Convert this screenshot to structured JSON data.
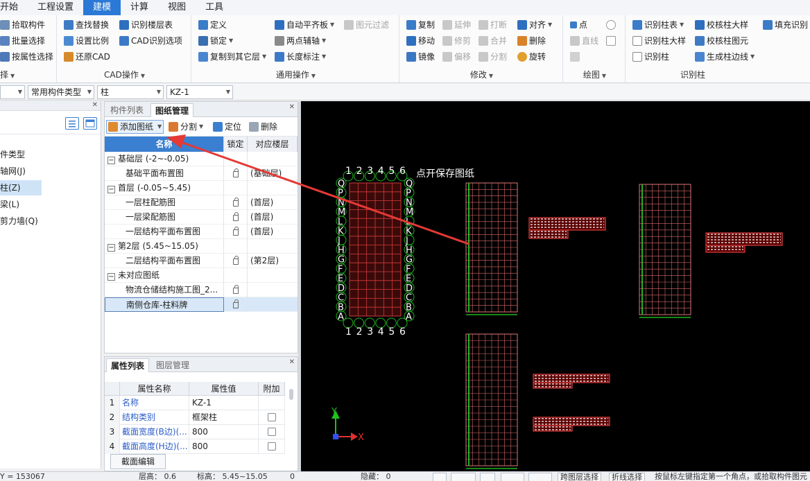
{
  "menu": [
    "开始",
    "工程设置",
    "建模",
    "计算",
    "视图",
    "工具"
  ],
  "ribbon": {
    "select_group": {
      "items": [
        "拾取构件",
        "批量选择",
        "按属性选择"
      ],
      "title": "择"
    },
    "cad_group": {
      "items": [
        "查找替换",
        "设置比例",
        "还原CAD",
        "识别楼层表",
        "CAD识别选项"
      ],
      "title": "CAD操作"
    },
    "general_group": {
      "items": [
        "定义",
        "锁定",
        "复制到其它层",
        "自动平齐板",
        "两点辅轴",
        "长度标注",
        "图元过滤"
      ],
      "title": "通用操作"
    },
    "modify_group": {
      "items": [
        "复制",
        "移动",
        "镜像",
        "延伸",
        "修剪",
        "偏移",
        "打断",
        "合并",
        "分割",
        "对齐",
        "删除",
        "旋转"
      ],
      "title": "修改"
    },
    "draw_group": {
      "items": [
        "点",
        "直线"
      ],
      "title": "绘图"
    },
    "recog_group": {
      "items": [
        "识别柱表",
        "识别柱大样",
        "识别柱",
        "校核柱大样",
        "校核柱图元",
        "生成柱边线",
        "填充识别"
      ],
      "title": "识别柱"
    }
  },
  "combos": [
    "",
    "常用构件类型",
    "柱",
    "KZ-1"
  ],
  "left_tree": [
    "件类型",
    "轴网(J)",
    "柱(Z)",
    "梁(L)",
    "剪力墙(Q)"
  ],
  "drawing_panel": {
    "tabs": [
      "构件列表",
      "图纸管理"
    ],
    "tools": [
      "添加图纸",
      "分割",
      "定位",
      "删除"
    ],
    "columns": [
      "名称",
      "锁定",
      "对应楼层"
    ],
    "rows": [
      {
        "type": "group",
        "name": "基础层 (-2~-0.05)",
        "floor": ""
      },
      {
        "type": "item",
        "name": "基础平面布置图",
        "floor": "(基础层)"
      },
      {
        "type": "group",
        "name": "首层 (-0.05~5.45)",
        "floor": ""
      },
      {
        "type": "item",
        "name": "一层柱配筋图",
        "floor": "(首层)"
      },
      {
        "type": "item",
        "name": "一层梁配筋图",
        "floor": "(首层)"
      },
      {
        "type": "item",
        "name": "一层结构平面布置图",
        "floor": "(首层)"
      },
      {
        "type": "group",
        "name": "第2层 (5.45~15.05)",
        "floor": ""
      },
      {
        "type": "item",
        "name": "二层结构平面布置图",
        "floor": "(第2层)"
      },
      {
        "type": "group",
        "name": "未对应图纸",
        "floor": ""
      },
      {
        "type": "item",
        "name": "物流仓储结构施工图_2...",
        "floor": ""
      },
      {
        "type": "item",
        "name": "南侧仓库-柱料牌",
        "floor": "",
        "selected": true
      }
    ]
  },
  "property_panel": {
    "tabs": [
      "属性列表",
      "图层管理"
    ],
    "columns": [
      "属性名称",
      "属性值",
      "附加"
    ],
    "rows": [
      {
        "num": "1",
        "name": "名称",
        "value": "KZ-1",
        "check": false
      },
      {
        "num": "2",
        "name": "结构类别",
        "value": "框架柱",
        "check": true
      },
      {
        "num": "3",
        "name": "截面宽度(B边)(...",
        "value": "800",
        "check": true
      },
      {
        "num": "4",
        "name": "截面高度(H边)(...",
        "value": "800",
        "check": true
      }
    ],
    "section_edit": "截面编辑"
  },
  "canvas": {
    "annotation": "点开保存图纸",
    "axis_numbers": "123456",
    "axis_letters": [
      "Q",
      "P",
      "N",
      "M",
      "L",
      "K",
      "J",
      "H",
      "G",
      "F",
      "E",
      "D",
      "C",
      "B",
      "A"
    ],
    "axis_y": "Y",
    "axis_x": "X"
  },
  "status": {
    "coord": "Y = 153067",
    "floor_height": "层高：  0.6",
    "elevation": "标高：  5.45~15.05",
    "zero": "0",
    "hidden": "隐藏：  0",
    "btn_layer": "跨图层选择",
    "btn_poly": "折线选择",
    "hint": "按鼠标左键指定第一个角点，或拾取构件图元"
  },
  "colors": {
    "accent": "#2b79d6",
    "arrow": "#e53935",
    "grid_green": "#1fb51f",
    "grid_red": "#d33b3b"
  }
}
